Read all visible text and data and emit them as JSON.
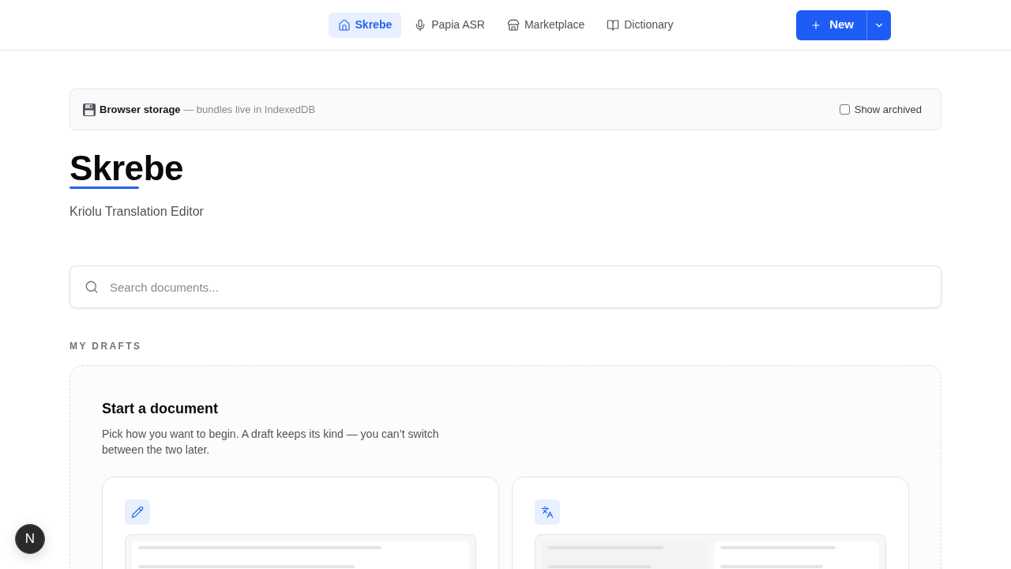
{
  "nav": {
    "tabs": [
      {
        "label": "Skrebe",
        "selected": true
      },
      {
        "label": "Papia ASR",
        "selected": false
      },
      {
        "label": "Marketplace",
        "selected": false
      },
      {
        "label": "Dictionary",
        "selected": false
      }
    ],
    "new_button": {
      "label": "New"
    }
  },
  "storage_banner": {
    "text": "**Browser storage** — bundles live in IndexedDB",
    "show_archived": {
      "label": "Show archived",
      "checked": false
    }
  },
  "hero": {
    "title": "Skrebe",
    "subtitle": "Kriolu Translation Editor"
  },
  "search": {
    "placeholder": "Search documents..."
  },
  "drafts": {
    "heading": "MY DRAFTS",
    "start": {
      "title": "Start a document",
      "description": "Pick how you want to begin. A draft keeps its kind — you can’t switch between the two later.",
      "options": [
        {
          "kind": "write"
        },
        {
          "kind": "translate"
        }
      ]
    }
  },
  "dev_indicator": {
    "label": "N"
  }
}
